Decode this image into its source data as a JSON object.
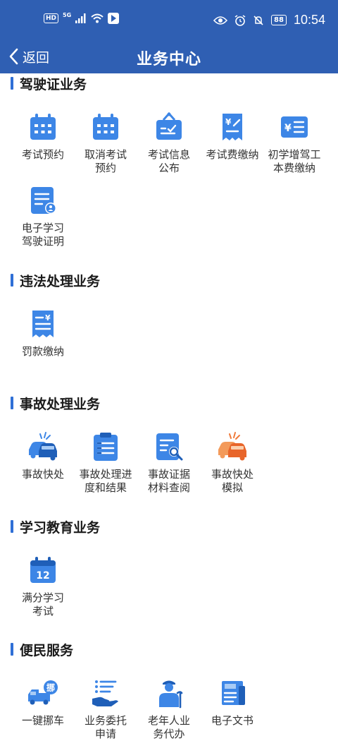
{
  "status_bar": {
    "hd": "HD",
    "network": "5G",
    "battery": "88",
    "time": "10:54"
  },
  "nav": {
    "back_label": "返回",
    "title": "业务中心"
  },
  "sections": [
    {
      "title": "驾驶证业务",
      "items": [
        {
          "label": "考试预约",
          "icon": "calendar-icon"
        },
        {
          "label": "取消考试\n预约",
          "icon": "calendar-icon"
        },
        {
          "label": "考试信息\n公布",
          "icon": "notice-board-icon"
        },
        {
          "label": "考试费缴纳",
          "icon": "fee-receipt-icon"
        },
        {
          "label": "初学增驾工\n本费缴纳",
          "icon": "yen-wallet-icon"
        },
        {
          "label": "电子学习\n驾驶证明",
          "icon": "certificate-icon"
        }
      ]
    },
    {
      "title": "违法处理业务",
      "items": [
        {
          "label": "罚款缴纳",
          "icon": "fine-receipt-icon"
        }
      ]
    },
    {
      "title": "事故处理业务",
      "items": [
        {
          "label": "事故快处",
          "icon": "car-collision-icon"
        },
        {
          "label": "事故处理进\n度和结果",
          "icon": "clipboard-icon"
        },
        {
          "label": "事故证据\n材料查阅",
          "icon": "document-search-icon"
        },
        {
          "label": "事故快处\n模拟",
          "icon": "car-collision-orange-icon"
        }
      ]
    },
    {
      "title": "学习教育业务",
      "items": [
        {
          "label": "满分学习\n考试",
          "icon": "calendar-12-icon",
          "badge": "12"
        }
      ]
    },
    {
      "title": "便民服务",
      "items": [
        {
          "label": "一键挪车",
          "icon": "tow-truck-icon",
          "badge": "挪"
        },
        {
          "label": "业务委托\n申请",
          "icon": "hand-list-icon"
        },
        {
          "label": "老年人业\n务代办",
          "icon": "elderly-person-icon"
        },
        {
          "label": "电子文书",
          "icon": "electronic-document-icon"
        }
      ]
    }
  ],
  "colors": {
    "brand_blue": "#2f5fb3",
    "icon_blue": "#3d86e6",
    "icon_orange": "#f07a3a"
  }
}
